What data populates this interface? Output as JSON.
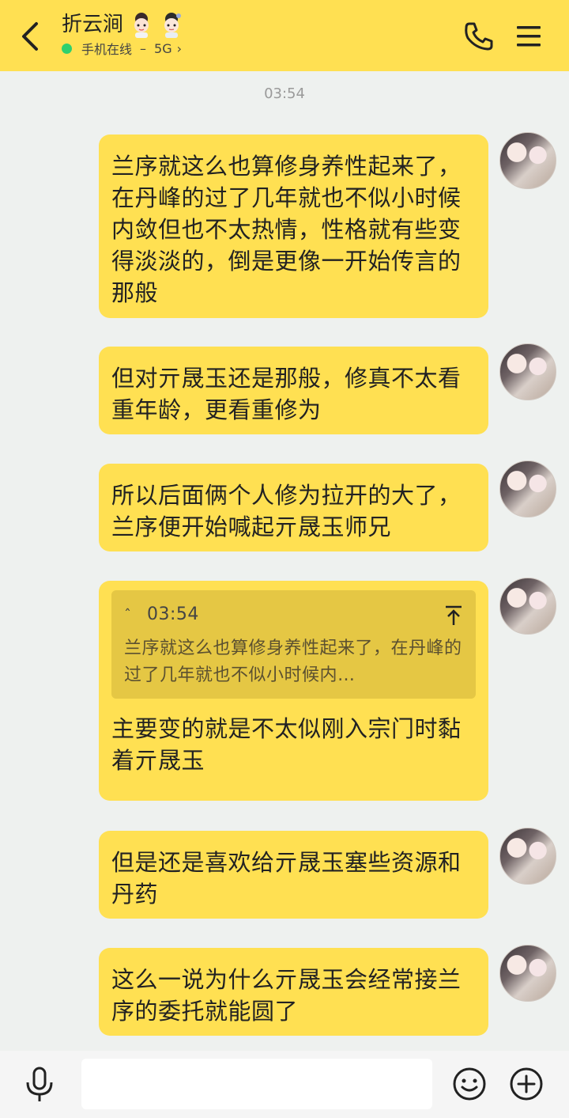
{
  "header": {
    "title": "折云涧",
    "status": "手机在线",
    "separator": "–",
    "network": "5G",
    "chevron": "›"
  },
  "icons": {
    "back": "back-arrow-icon",
    "call": "phone-icon",
    "menu": "menu-icon",
    "mic": "microphone-icon",
    "emoji": "smiley-icon",
    "plus": "plus-circle-icon",
    "quote_top": "scroll-to-top-icon"
  },
  "colors": {
    "header_bg": "#ffe052",
    "bubble_bg": "#ffe052",
    "quote_bg": "#e5c744",
    "online": "#2ed06e",
    "chat_bg": "#eef1ef"
  },
  "timestamp": "03:54",
  "messages": [
    {
      "text": "兰序就这么也算修身养性起来了，在丹峰的过了几年就也不似小时候内敛但也不太热情，性格就有些变得淡淡的，倒是更像一开始传言的那般"
    },
    {
      "text": "但对亓晟玉还是那般，修真不太看重年龄，更看重修为"
    },
    {
      "text": "所以后面俩个人修为拉开的大了，兰序便开始喊起亓晟玉师兄"
    },
    {
      "quote": {
        "caret": "ˆ",
        "time": "03:54",
        "text": "兰序就这么也算修身养性起来了，在丹峰的过了几年就也不似小时候内…"
      },
      "text": "主要变的就是不太似刚入宗门时黏着亓晟玉"
    },
    {
      "text": "但是还是喜欢给亓晟玉塞些资源和丹药"
    },
    {
      "text": "这么一说为什么亓晟玉会经常接兰序的委托就能圆了"
    }
  ],
  "input": {
    "value": "",
    "placeholder": ""
  }
}
